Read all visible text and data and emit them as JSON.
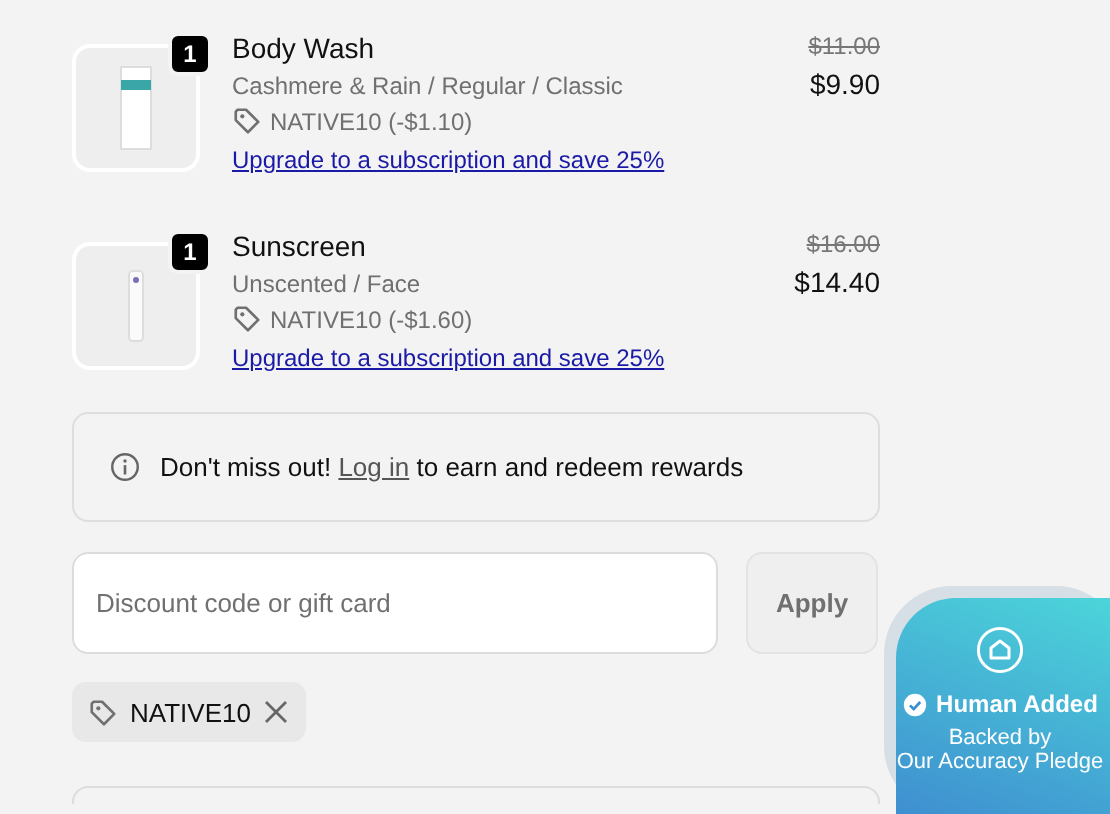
{
  "items": [
    {
      "name": "Body Wash",
      "quantity": "1",
      "variant": "Cashmere & Rain / Regular / Classic",
      "discount": "NATIVE10 (-$1.10)",
      "upgrade_link": "Upgrade to a subscription and save 25%",
      "original_price": "$11.00",
      "price": "$9.90",
      "kind": "tall"
    },
    {
      "name": "Sunscreen",
      "quantity": "1",
      "variant": "Unscented / Face",
      "discount": "NATIVE10 (-$1.60)",
      "upgrade_link": "Upgrade to a subscription and save 25%",
      "original_price": "$16.00",
      "price": "$14.40",
      "kind": "tube"
    }
  ],
  "rewards_banner": {
    "before": "Don't miss out!",
    "link": "Log in",
    "after": "to earn and redeem rewards"
  },
  "discount_field": {
    "placeholder": "Discount code or gift card",
    "button": "Apply"
  },
  "applied_code": {
    "code": "NATIVE10"
  },
  "trust_badge": {
    "title": "Human Added",
    "subtitle": "Backed by",
    "subtitle_2": "Our Accuracy Pledge"
  }
}
